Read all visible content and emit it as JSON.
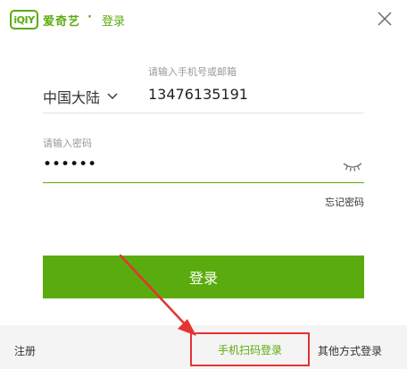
{
  "header": {
    "logo_text": "iQIY",
    "brand": "爱奇艺",
    "separator": "·",
    "title": "登录",
    "close_icon": "close-icon"
  },
  "form": {
    "phone_label": "请输入手机号或邮箱",
    "region": "中国大陆",
    "phone_value": "13476135191",
    "password_label": "请输入密码",
    "password_value": "••••••",
    "eye_icon": "eye-closed-icon",
    "forgot_password": "忘记密码",
    "login_button": "登录"
  },
  "footer": {
    "register": "注册",
    "qr_login": "手机扫码登录",
    "other_login": "其他方式登录"
  },
  "colors": {
    "brand_green": "#5aac0e",
    "annotation_red": "#e63232",
    "footer_bg": "#f4f4f4"
  }
}
